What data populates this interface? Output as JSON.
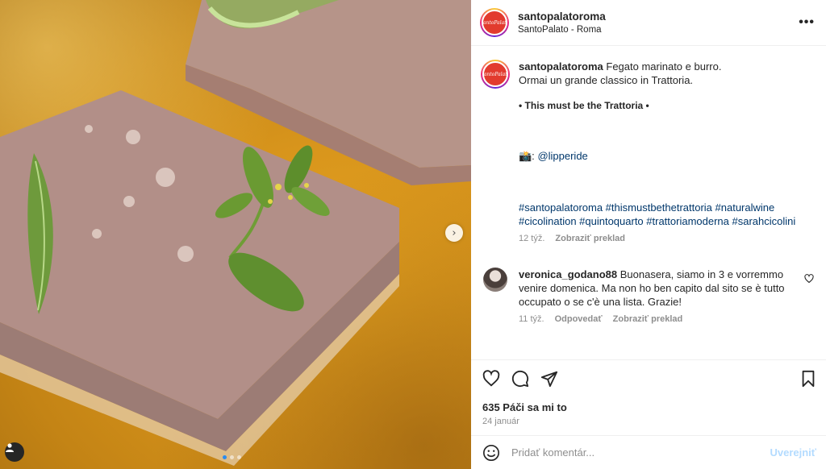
{
  "post": {
    "username": "santopalatoroma",
    "location": "SantoPalato - Roma",
    "more_icon": "more-dots-icon",
    "avatar_text": "SantoPalato"
  },
  "caption": {
    "username": "santopalatoroma",
    "line1": "Fegato marinato e burro.",
    "line2": "Ormai un grande classico in Trattoria.",
    "bold_line": "• This must be the Trattoria •",
    "camera_emoji": "📸:",
    "credit": "@lipperide",
    "hashtags": "#santopalatoroma #thismustbethetrattoria #naturalwine #cicolination #quintoquarto #trattoriamoderna #sarahcicolini",
    "time": "12 týž.",
    "translate": "Zobraziť preklad"
  },
  "comment": {
    "username": "veronica_godano88",
    "text": "Buonasera, siamo in 3 e vorremmo venire domenica. Ma non ho ben capito dal sito se è tutto occupato o se c'è una lista. Grazie!",
    "time": "11 týž.",
    "reply": "Odpovedať",
    "translate": "Zobraziť preklad"
  },
  "stats": {
    "likes": "635 Páči sa mi to",
    "date": "24 január"
  },
  "composer": {
    "placeholder": "Pridať komentár...",
    "post_label": "Uverejniť"
  },
  "carousel": {
    "slides": 3,
    "active_index": 0
  },
  "colors": {
    "link": "#00376b",
    "muted": "#8e8e8e",
    "post_disabled": "#b3dbff",
    "active_dot": "#2a8cf0"
  }
}
